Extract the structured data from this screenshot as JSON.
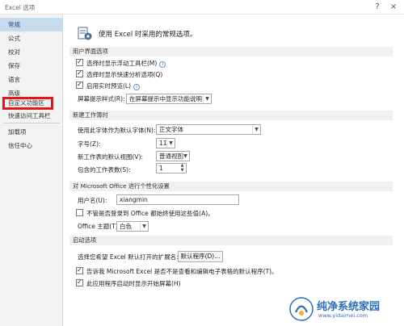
{
  "window": {
    "title": "Excel 选项",
    "help_label": "?",
    "close_label": "×"
  },
  "sidebar": {
    "items": [
      {
        "label": "常规"
      },
      {
        "label": "公式"
      },
      {
        "label": "校对"
      },
      {
        "label": "保存"
      },
      {
        "label": "语言"
      },
      {
        "label": "高级"
      },
      {
        "label": "自定义功能区"
      },
      {
        "label": "快速访问工具栏"
      },
      {
        "label": "加载项"
      },
      {
        "label": "信任中心"
      }
    ]
  },
  "header": {
    "text": "使用 Excel 时采用的常规选项。",
    "icon": "options-settings-icon"
  },
  "ui_options": {
    "section_title": "用户界面选项",
    "mini_toolbar": "选择时显示浮动工具栏(M)",
    "quick_analysis": "选择时显示快速分析选项(Q)",
    "live_preview": "启用实时预览(L)",
    "screentip_label": "屏幕提示样式(R):",
    "screentip_value": "在屏幕提示中显示功能说明"
  },
  "new_workbook": {
    "section_title": "新建工作簿时",
    "font_label": "使用此字体作为默认字体(N):",
    "font_value": "正文字体",
    "size_label": "字号(Z):",
    "size_value": "11",
    "view_label": "新工作表的默认视图(V):",
    "view_value": "普通视图",
    "sheets_label": "包含的工作表数(S):",
    "sheets_value": "1"
  },
  "personalize": {
    "section_title": "对 Microsoft Office 进行个性化设置",
    "username_label": "用户名(U):",
    "username_value": "xiangmin",
    "always_use_label": "不管是否登录到 Office 都始终使用这些值(A)。",
    "theme_label": "Office 主题(T):",
    "theme_value": "白色"
  },
  "startup": {
    "section_title": "启动选项",
    "ext_label": "选择您希望 Excel 默认打开的扩展名:",
    "default_programs_button": "默认程序(D)...",
    "tell_me_label": "告诉我 Microsoft Excel 是否不是查看和编辑电子表格的默认程序(T)。",
    "show_start_label": "此应用程序启动时显示开始屏幕(H)"
  },
  "watermark": {
    "text": "纯净系统家园",
    "url": "www.yidaimei.com"
  },
  "colors": {
    "active_item": "#c6dbee",
    "highlight_box": "#e8141b",
    "accent": "#2d6fb7"
  }
}
